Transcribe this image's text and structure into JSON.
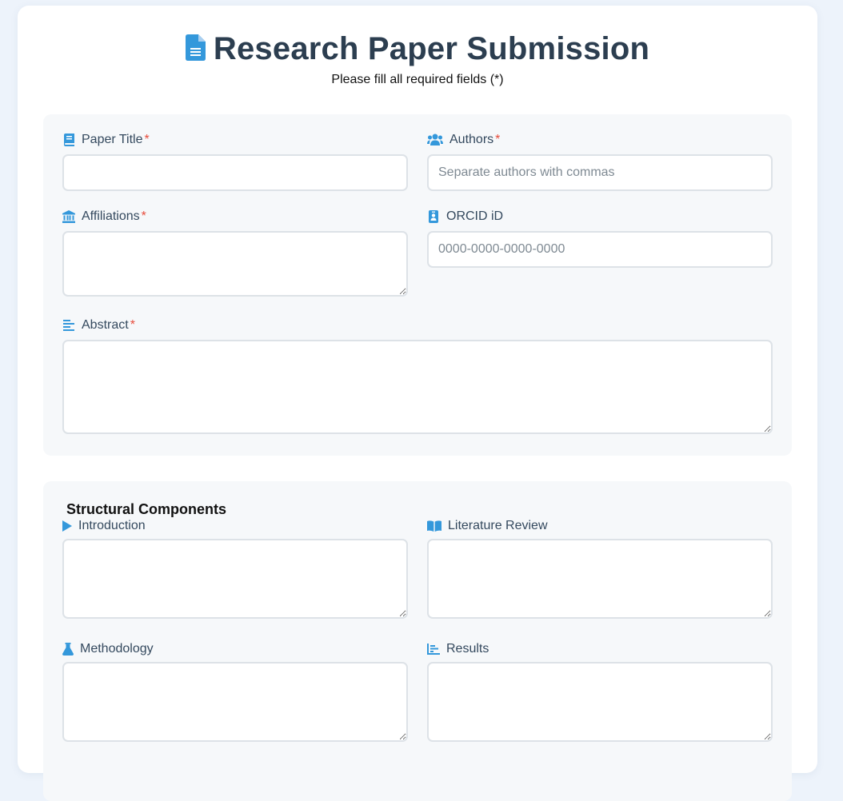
{
  "header": {
    "title": "Research Paper Submission",
    "subtitle": "Please fill all required fields (*)",
    "icon": "file-text-icon"
  },
  "accent_color": "#3498db",
  "required_color": "#e74c3c",
  "details": {
    "paper_title": {
      "label": "Paper Title",
      "required": "*",
      "placeholder": "",
      "value": ""
    },
    "authors": {
      "label": "Authors",
      "required": "*",
      "placeholder": "Separate authors with commas",
      "value": ""
    },
    "affiliations": {
      "label": "Affiliations",
      "required": "*",
      "placeholder": "",
      "value": ""
    },
    "orcid": {
      "label": "ORCID iD",
      "placeholder": "0000-0000-0000-0000",
      "value": ""
    },
    "abstract": {
      "label": "Abstract",
      "required": "*",
      "placeholder": "",
      "value": ""
    }
  },
  "structure": {
    "heading": "Structural Components",
    "introduction": {
      "label": "Introduction"
    },
    "literature_review": {
      "label": "Literature Review"
    },
    "methodology": {
      "label": "Methodology"
    },
    "results": {
      "label": "Results"
    }
  }
}
